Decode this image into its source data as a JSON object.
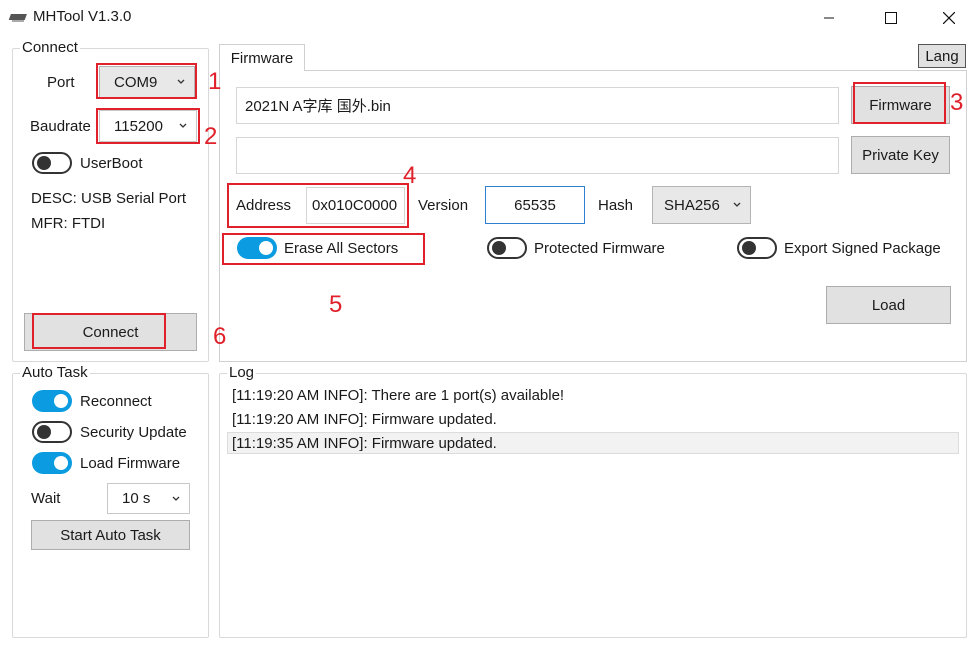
{
  "window": {
    "title": "MHTool V1.3.0"
  },
  "connect": {
    "legend": "Connect",
    "port_label": "Port",
    "port_value": "COM9",
    "baud_label": "Baudrate",
    "baud_value": "115200",
    "userboot_label": "UserBoot",
    "userboot_on": false,
    "desc": "DESC: USB Serial Port",
    "mfr": "MFR: FTDI",
    "connect_button": "Connect"
  },
  "auto_task": {
    "legend": "Auto Task",
    "reconnect_label": "Reconnect",
    "reconnect_on": true,
    "security_update_label": "Security Update",
    "security_update_on": false,
    "load_firmware_label": "Load Firmware",
    "load_firmware_on": true,
    "wait_label": "Wait",
    "wait_value": "10 s",
    "start_button": "Start Auto Task"
  },
  "firmware": {
    "tab_label": "Firmware",
    "lang_button": "Lang",
    "file_value": "2021N A字库 国外.bin",
    "key_value": "",
    "firmware_button": "Firmware",
    "private_key_button": "Private Key",
    "address_label": "Address",
    "address_value": "0x010C0000",
    "version_label": "Version",
    "version_value": "65535",
    "hash_label": "Hash",
    "hash_value": "SHA256",
    "erase_label": "Erase All Sectors",
    "erase_on": true,
    "protected_label": "Protected Firmware",
    "protected_on": false,
    "export_label": "Export Signed Package",
    "export_on": false,
    "load_button": "Load"
  },
  "log": {
    "legend": "Log",
    "lines": [
      "[11:19:20 AM INFO]: There are 1 port(s) available!",
      "[11:19:20 AM INFO]: Firmware updated.",
      "[11:19:35 AM INFO]: Firmware updated."
    ]
  },
  "annotations": [
    "1",
    "2",
    "3",
    "4",
    "5",
    "6"
  ],
  "colors": {
    "accent": "#0b9be0",
    "annotation": "#e0202a"
  }
}
